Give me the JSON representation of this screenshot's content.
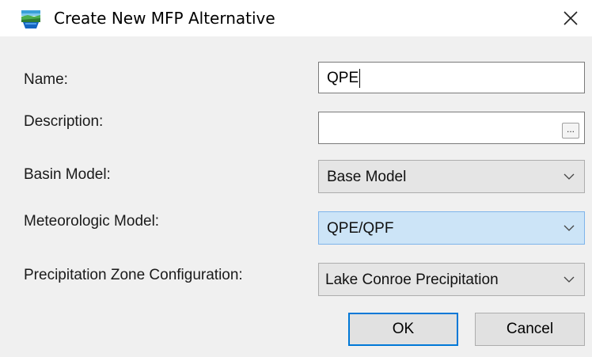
{
  "window": {
    "title": "Create New MFP Alternative",
    "app_icon": "hec-hms-landscape-icon",
    "close_icon": "close-icon"
  },
  "form": {
    "name": {
      "label": "Name:",
      "value": "QPE"
    },
    "description": {
      "label": "Description:",
      "value": "",
      "browse_label": "..."
    },
    "basin_model": {
      "label": "Basin Model:",
      "selected": "Base Model"
    },
    "meteorologic_model": {
      "label": "Meteorologic Model:",
      "selected": "QPE/QPF"
    },
    "precipitation_zone": {
      "label": "Precipitation Zone Configuration:",
      "selected": "Lake Conroe Precipitation"
    }
  },
  "buttons": {
    "ok_label": "OK",
    "cancel_label": "Cancel"
  },
  "colors": {
    "dialog_background": "#f0f0f0",
    "focused_combo": "#cce4f7",
    "default_button_border": "#0078d7"
  }
}
